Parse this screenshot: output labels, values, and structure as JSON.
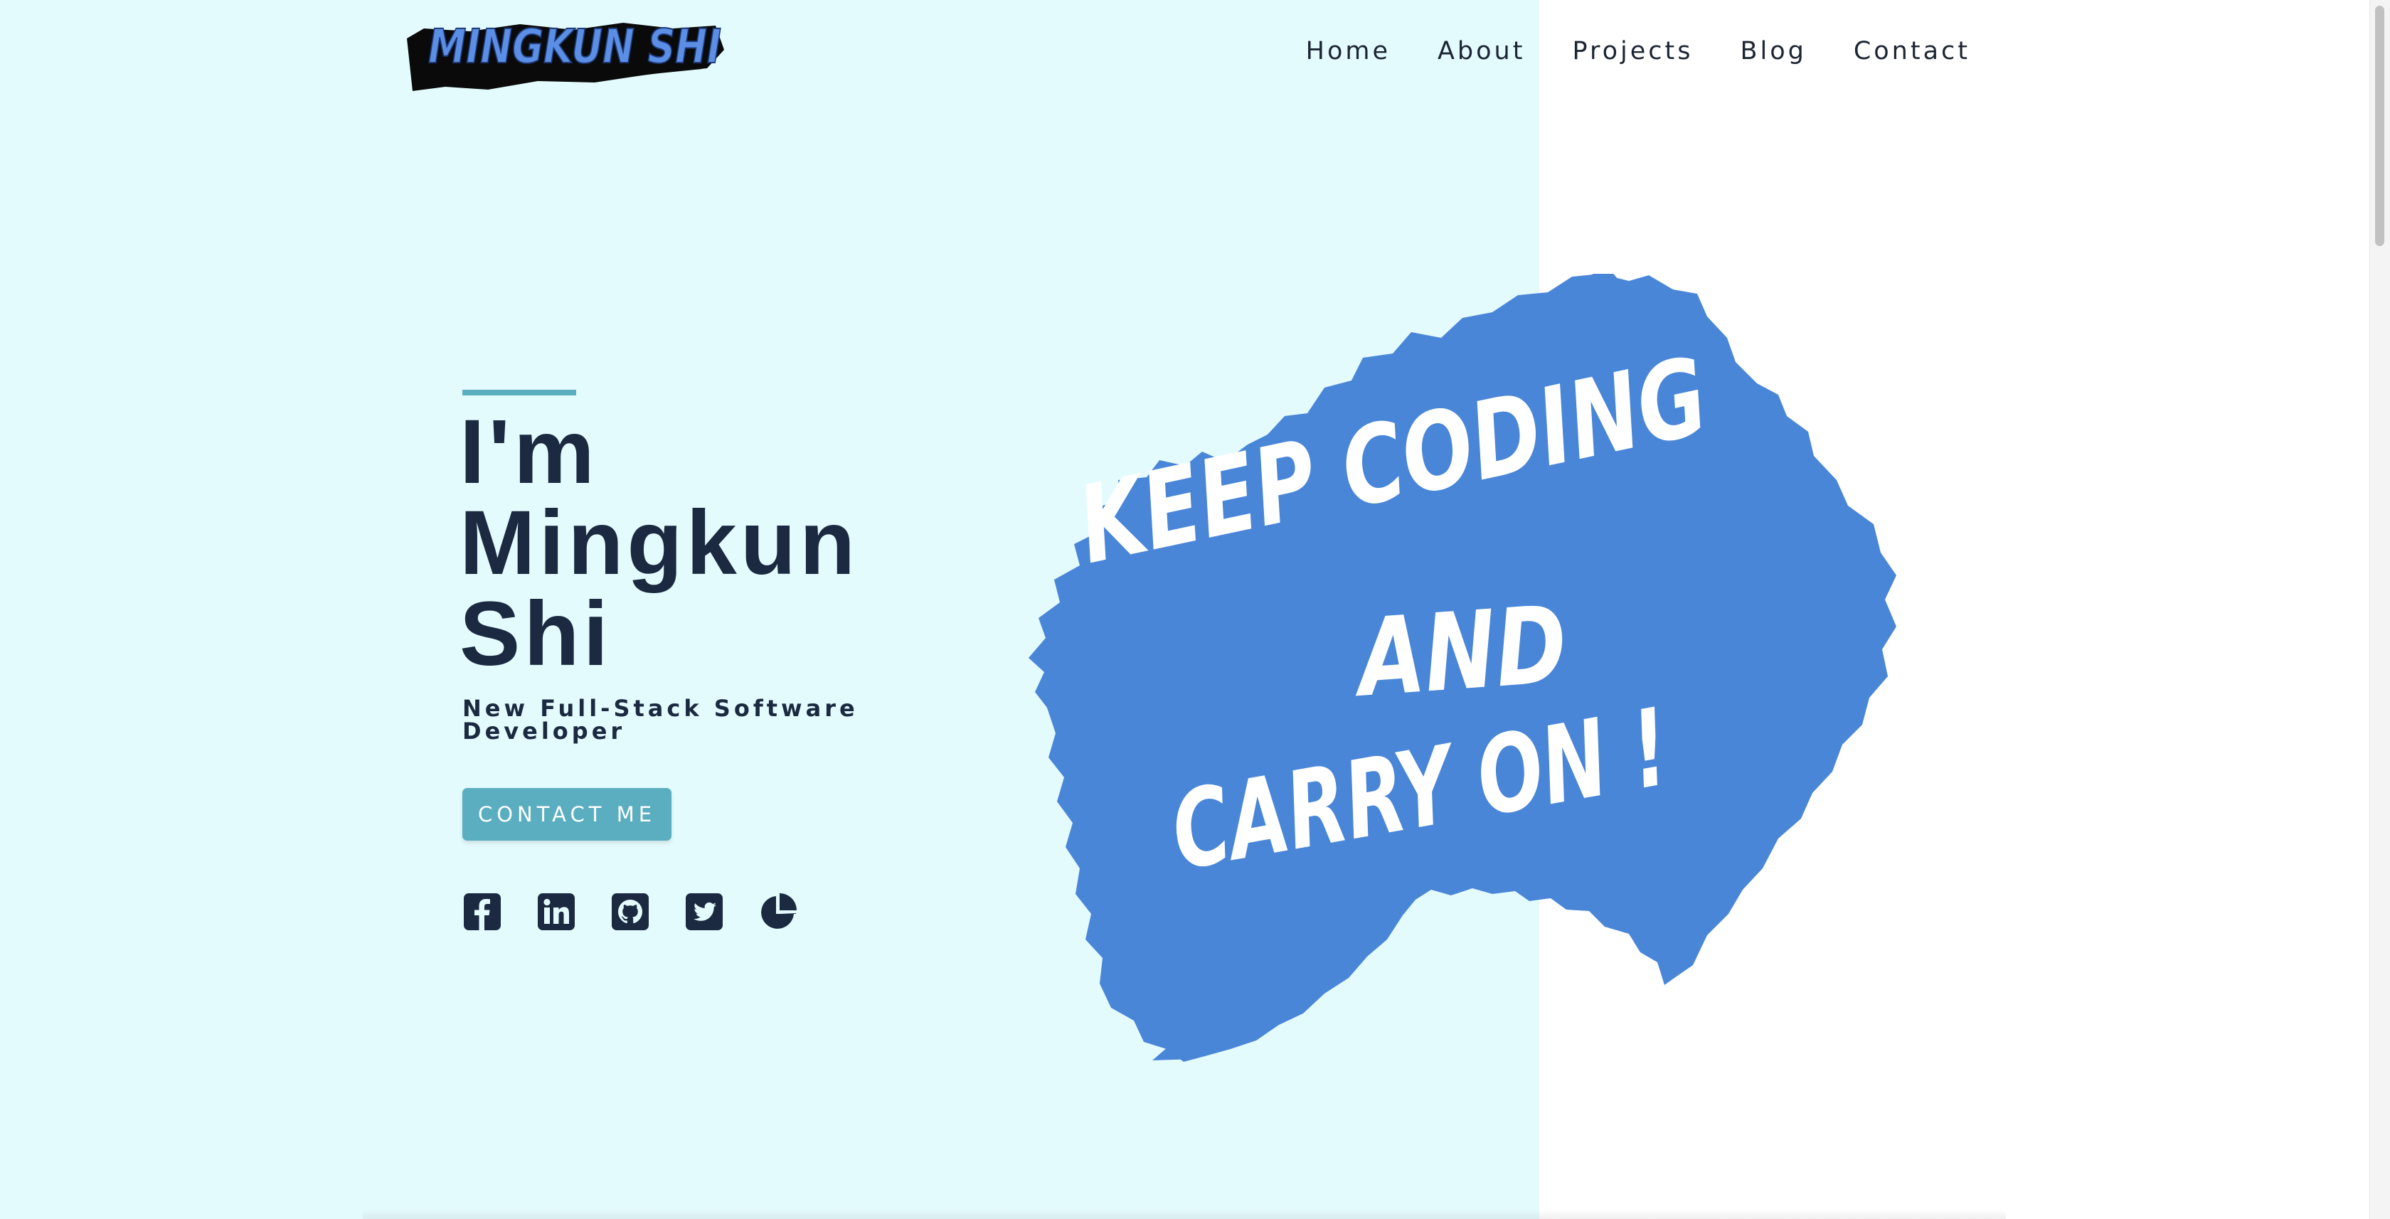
{
  "logo": {
    "text": "MINGKUN SHI",
    "color": "#5b8fe6",
    "shadow_color": "#0a0a0a"
  },
  "nav": {
    "items": [
      {
        "label": "Home"
      },
      {
        "label": "About"
      },
      {
        "label": "Projects"
      },
      {
        "label": "Blog"
      },
      {
        "label": "Contact"
      }
    ]
  },
  "hero": {
    "title_lines": [
      "I'm",
      "Mingkun",
      "Shi"
    ],
    "subtitle": "New Full-Stack Software Developer",
    "cta_label": "CONTACT ME",
    "accent_color": "#5aaec0",
    "text_color": "#1b2a40"
  },
  "socials": [
    {
      "icon": "facebook-icon"
    },
    {
      "icon": "linkedin-icon"
    },
    {
      "icon": "github-icon"
    },
    {
      "icon": "twitter-icon"
    },
    {
      "icon": "pie-chart-icon"
    }
  ],
  "graphic": {
    "lines": [
      "KEEP CODING",
      "AND",
      "CARRY ON !"
    ],
    "blob_color": "#4a86d8",
    "text_color": "#ffffff"
  },
  "colors": {
    "left_background": "#e4fbfe",
    "right_background": "#ffffff"
  }
}
